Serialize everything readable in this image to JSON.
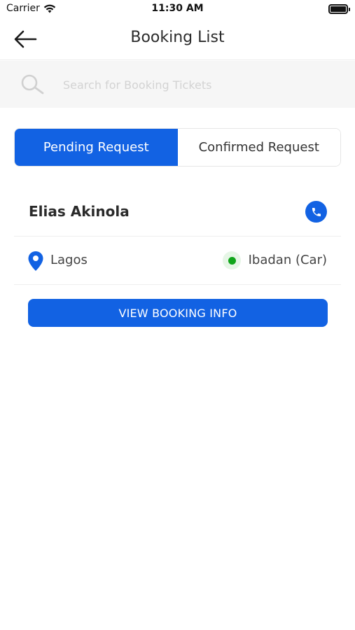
{
  "status_bar": {
    "carrier": "Carrier",
    "time": "11:30 AM"
  },
  "nav": {
    "title": "Booking List",
    "back_icon": "arrow-left-icon"
  },
  "search": {
    "placeholder": "Search for Booking Tickets",
    "value": "",
    "icon": "search-icon"
  },
  "tabs": [
    {
      "label": "Pending Request",
      "active": true
    },
    {
      "label": "Confirmed Request",
      "active": false
    }
  ],
  "booking": {
    "name": "Elias Akinola",
    "origin": "Lagos",
    "destination": "Ibadan (Car)",
    "button_label": "VIEW BOOKING INFO"
  },
  "colors": {
    "accent": "#1262e3",
    "destination_dot": "#11a51b",
    "search_bg": "#f6f6f6"
  }
}
